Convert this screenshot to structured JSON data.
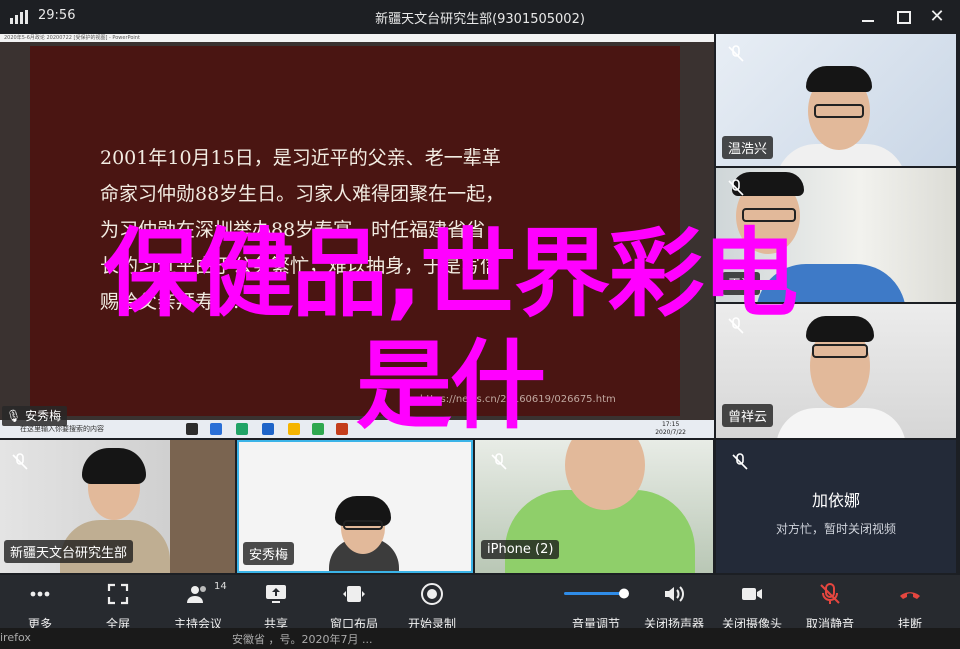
{
  "titlebar": {
    "time": "29:56",
    "title": "新疆天文台研究生部(9301505002)",
    "icons": [
      "signal-icon",
      "minimize-icon",
      "maximize-icon",
      "close-icon"
    ]
  },
  "shared_screen": {
    "window_caption": "2020年5-6月政论 20200722 [受保护的视图] - PowerPoint",
    "slide_lines": [
      "2001年10月15日，是习近平的父亲、老一辈革",
      "命家习仲勋88岁生日。习家人难得团聚在一起，",
      "为习仲勋在深圳举办88岁寿宴。时任福建省省",
      "长的习近平由于公务繁忙，难以抽身，于是写信",
      "赐给父亲拜寿……"
    ],
    "slide_url": "https://news.cn/20160619/026675.htm",
    "taskbar_search": "在这里输入你要搜索的内容",
    "clock_time": "17:15",
    "clock_date": "2020/7/22",
    "presenter_name": "安秀梅"
  },
  "participants_right": [
    {
      "name": "温浩兴",
      "muted": true
    },
    {
      "name": "王浩",
      "muted": true
    },
    {
      "name": "曾祥云",
      "muted": true
    }
  ],
  "participants_bottom": [
    {
      "name": "新疆天文台研究生部",
      "muted": true
    },
    {
      "name": "安秀梅",
      "muted": false
    },
    {
      "name": "iPhone (2)",
      "muted": true
    }
  ],
  "video_off_tile": {
    "name": "加依娜",
    "status": "对方忙，暂时关闭视频"
  },
  "overlay_text": {
    "line1": "保健品,世界彩电",
    "line2": "是什"
  },
  "toolbar": {
    "participant_count": "14",
    "items": [
      {
        "label": "更多",
        "icon": "more-icon"
      },
      {
        "label": "全屏",
        "icon": "fullscreen-icon"
      },
      {
        "label": "主持会议",
        "icon": "host-meeting-icon"
      },
      {
        "label": "共享",
        "icon": "share-screen-icon"
      },
      {
        "label": "窗口布局",
        "icon": "window-layout-icon"
      },
      {
        "label": "开始录制",
        "icon": "record-icon"
      },
      {
        "label": "音量调节",
        "icon": "volume-slider-icon"
      },
      {
        "label": "关闭扬声器",
        "icon": "speaker-icon"
      },
      {
        "label": "关闭摄像头",
        "icon": "camera-icon"
      },
      {
        "label": "取消静音",
        "icon": "mic-muted-icon"
      },
      {
        "label": "挂断",
        "icon": "hangup-icon"
      }
    ]
  },
  "under_strip": {
    "left": "irefox",
    "mid": "安徽省 ，号。2020年7月 ..."
  },
  "colors": {
    "overlay": "#ff00ff",
    "hangup": "#e5463f",
    "volume_accent": "#2f8ce8",
    "muted_mic": "#e5463f"
  }
}
